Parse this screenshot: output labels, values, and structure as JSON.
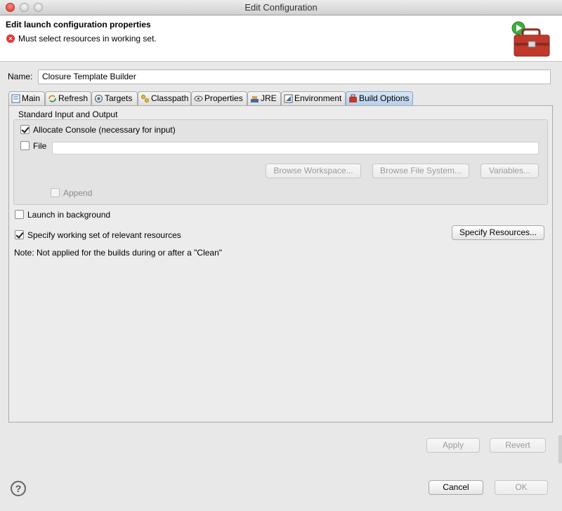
{
  "window": {
    "title": "Edit Configuration"
  },
  "header": {
    "title": "Edit launch configuration properties",
    "error_message": "Must select resources in working set."
  },
  "name": {
    "label": "Name:",
    "value": "Closure Template Builder"
  },
  "tabs": [
    {
      "label": "Main",
      "icon": "main-tab-icon"
    },
    {
      "label": "Refresh",
      "icon": "refresh-icon"
    },
    {
      "label": "Targets",
      "icon": "targets-icon"
    },
    {
      "label": "Classpath",
      "icon": "classpath-icon"
    },
    {
      "label": "Properties",
      "icon": "properties-icon"
    },
    {
      "label": "JRE",
      "icon": "jre-icon"
    },
    {
      "label": "Environment",
      "icon": "environment-icon"
    },
    {
      "label": "Build Options",
      "icon": "build-options-icon",
      "active": true
    }
  ],
  "standard_io": {
    "group_label": "Standard Input and Output",
    "allocate_console": {
      "label": "Allocate Console (necessary for input)",
      "checked": true
    },
    "file": {
      "label": "File",
      "checked": false,
      "value": ""
    },
    "browse_workspace": "Browse Workspace...",
    "browse_file_system": "Browse File System...",
    "variables": "Variables...",
    "append": {
      "label": "Append",
      "checked": false
    }
  },
  "launch_background": {
    "label": "Launch in background",
    "checked": false
  },
  "working_set": {
    "label": "Specify working set of relevant resources",
    "checked": true
  },
  "specify_resources": "Specify Resources...",
  "note": "Note: Not applied for the builds during or after a \"Clean\"",
  "buttons": {
    "apply": "Apply",
    "revert": "Revert",
    "cancel": "Cancel",
    "ok": "OK"
  },
  "colors": {
    "active_tab": "#b7cfea",
    "error": "#e03a3a",
    "toolbox": "#c0392b",
    "run_badge": "#3fae3f"
  }
}
